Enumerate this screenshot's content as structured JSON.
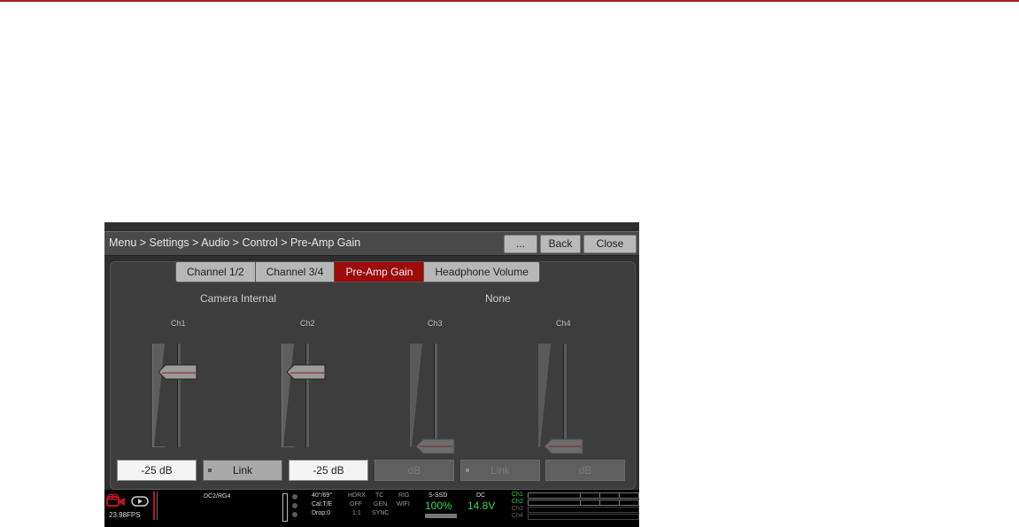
{
  "titlebar": {
    "breadcrumb": "Menu > Settings > Audio > Control > Pre-Amp Gain",
    "more_label": "...",
    "back_label": "Back",
    "close_label": "Close"
  },
  "tabs": [
    {
      "label": "Channel 1/2",
      "active": false
    },
    {
      "label": "Channel 3/4",
      "active": false
    },
    {
      "label": "Pre-Amp Gain",
      "active": true
    },
    {
      "label": "Headphone Volume",
      "active": false
    }
  ],
  "groups": [
    {
      "label": "Camera Internal"
    },
    {
      "label": "None"
    }
  ],
  "channels": [
    {
      "label": "Ch1",
      "value": "-25 dB",
      "enabled": true
    },
    {
      "label": "Ch2",
      "value": "-25 dB",
      "enabled": true
    },
    {
      "label": "Ch3",
      "value": "dB",
      "enabled": false
    },
    {
      "label": "Ch4",
      "value": "dB",
      "enabled": false
    }
  ],
  "links": [
    {
      "label": "Link",
      "enabled": true
    },
    {
      "label": "Link",
      "enabled": false
    }
  ],
  "status": {
    "fps": "23.98FPS",
    "format": "DC2/RG4",
    "shutter": "40°/69°",
    "cal": "Cal:T/E",
    "drop": "Drop:0",
    "hdrx_label": "HDRX",
    "hdrx_value": "OFF",
    "aspect": "1:1",
    "tc_label": "TC",
    "tc_value": "GEN",
    "sync_label": "SYNC",
    "rig_label": "RIG",
    "wifi_label": "WIFI",
    "media_label": "S-SSD",
    "media_value": "100%",
    "power_label": "DC",
    "power_value": "14.8V",
    "audio_channels": [
      "Ch1",
      "Ch2",
      "Ch3",
      "Ch4"
    ],
    "colors": {
      "accent_red": "#9d0b0b",
      "status_green": "#35d64a"
    }
  }
}
